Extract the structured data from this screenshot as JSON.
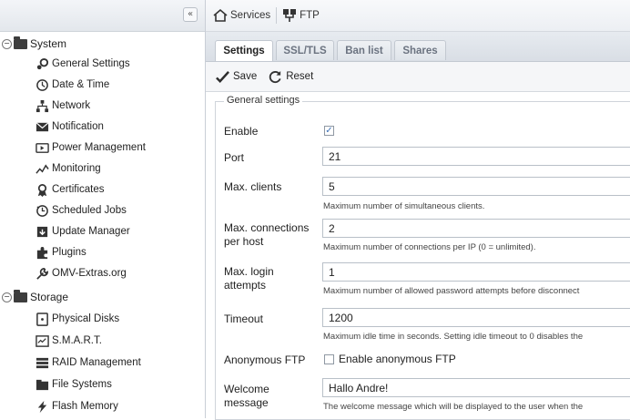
{
  "sidebar": {
    "collapse_glyph": "«",
    "groups": [
      {
        "label": "System",
        "toggle": "−",
        "items": [
          {
            "label": "General Settings",
            "icon": "gears-icon"
          },
          {
            "label": "Date & Time",
            "icon": "clock-icon"
          },
          {
            "label": "Network",
            "icon": "network-icon"
          },
          {
            "label": "Notification",
            "icon": "envelope-icon"
          },
          {
            "label": "Power Management",
            "icon": "power-icon"
          },
          {
            "label": "Monitoring",
            "icon": "chart-line-icon"
          },
          {
            "label": "Certificates",
            "icon": "certificate-icon"
          },
          {
            "label": "Scheduled Jobs",
            "icon": "scheduled-clock-icon"
          },
          {
            "label": "Update Manager",
            "icon": "update-icon"
          },
          {
            "label": "Plugins",
            "icon": "puzzle-icon"
          },
          {
            "label": "OMV-Extras.org",
            "icon": "wrench-icon"
          }
        ]
      },
      {
        "label": "Storage",
        "toggle": "−",
        "items": [
          {
            "label": "Physical Disks",
            "icon": "disk-icon"
          },
          {
            "label": "S.M.A.R.T.",
            "icon": "smart-icon"
          },
          {
            "label": "RAID Management",
            "icon": "raid-icon"
          },
          {
            "label": "File Systems",
            "icon": "filesystem-icon"
          },
          {
            "label": "Flash Memory",
            "icon": "flash-icon"
          }
        ]
      }
    ]
  },
  "breadcrumb": {
    "items": [
      {
        "label": "Services",
        "icon": "home-icon"
      },
      {
        "label": "FTP",
        "icon": "ftp-icon"
      }
    ]
  },
  "tabs": [
    {
      "label": "Settings",
      "active": true
    },
    {
      "label": "SSL/TLS",
      "active": false
    },
    {
      "label": "Ban list",
      "active": false
    },
    {
      "label": "Shares",
      "active": false
    }
  ],
  "toolbar": {
    "save_label": "Save",
    "reset_label": "Reset"
  },
  "form": {
    "legend": "General settings",
    "enable": {
      "label": "Enable",
      "checked": true
    },
    "port": {
      "label": "Port",
      "value": "21"
    },
    "max_clients": {
      "label": "Max. clients",
      "value": "5",
      "help": "Maximum number of simultaneous clients."
    },
    "max_conn": {
      "label_1": "Max. connections",
      "label_2": "per host",
      "value": "2",
      "help": "Maximum number of connections per IP (0 = unlimited)."
    },
    "max_login": {
      "label_1": "Max. login",
      "label_2": "attempts",
      "value": "1",
      "help": "Maximum number of allowed password attempts before disconnect"
    },
    "timeout": {
      "label": "Timeout",
      "value": "1200",
      "help": "Maximum idle time in seconds. Setting idle timeout to 0 disables the"
    },
    "anon": {
      "label": "Anonymous FTP",
      "checked": false,
      "checkbox_label": "Enable anonymous FTP"
    },
    "welcome": {
      "label_1": "Welcome",
      "label_2": "message",
      "value": "Hallo Andre!",
      "help": "The welcome message which will be displayed to the user when the"
    }
  },
  "colors": {
    "sidebar_bg": "#ffffff",
    "tab_active": "#ffffff",
    "accent_check": "#3b6fb6",
    "save_check": "#2d2d2d"
  }
}
